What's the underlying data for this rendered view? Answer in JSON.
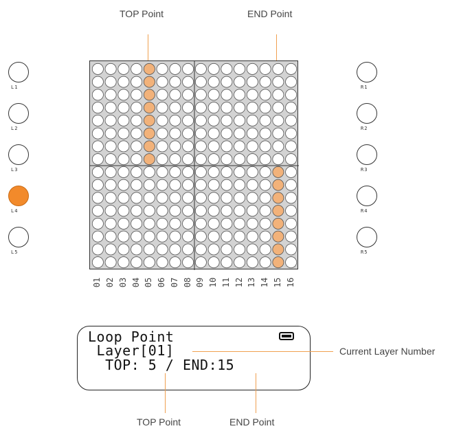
{
  "callouts": {
    "top_point_upper": "TOP Point",
    "end_point_upper": "END Point",
    "current_layer": "Current Layer Number",
    "top_point_lower": "TOP Point",
    "end_point_lower": "END Point"
  },
  "left_buttons": [
    {
      "label": "L1",
      "active": false
    },
    {
      "label": "L2",
      "active": false
    },
    {
      "label": "L3",
      "active": false
    },
    {
      "label": "L4",
      "active": true
    },
    {
      "label": "L5",
      "active": false
    }
  ],
  "right_buttons": [
    {
      "label": "R1",
      "active": false
    },
    {
      "label": "R2",
      "active": false
    },
    {
      "label": "R3",
      "active": false
    },
    {
      "label": "R4",
      "active": false
    },
    {
      "label": "R5",
      "active": false
    }
  ],
  "grid": {
    "columns": 16,
    "rows": 16,
    "column_labels": [
      "01",
      "02",
      "03",
      "04",
      "05",
      "06",
      "07",
      "08",
      "09",
      "10",
      "11",
      "12",
      "13",
      "14",
      "15",
      "16"
    ],
    "top_point": {
      "column": 5,
      "rows": "1-8"
    },
    "end_point": {
      "column": 15,
      "rows": "9-16"
    }
  },
  "lcd": {
    "line1": "Loop Point",
    "line2": " Layer[01]",
    "line3": "  TOP: 5 / END:15"
  },
  "colors": {
    "active_button": "#f28a2b",
    "highlight_pad": "#f2b27a",
    "leader_line": "#f0a050",
    "grid_background": "#d3d3d3"
  }
}
